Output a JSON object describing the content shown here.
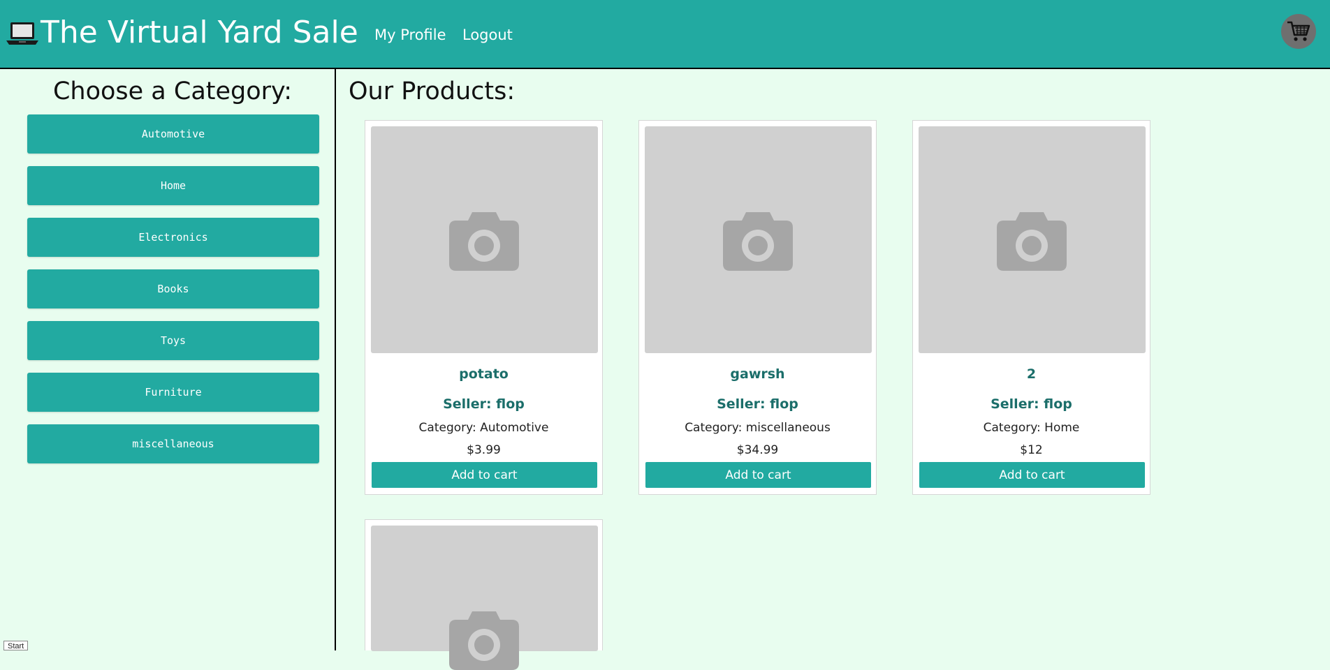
{
  "header": {
    "logo_icon": "laptop-icon",
    "title": "The Virtual Yard Sale",
    "nav": {
      "profile": "My Profile",
      "logout": "Logout"
    },
    "cart_icon": "shopping-cart-icon",
    "background": "#22aaa1"
  },
  "sidebar": {
    "heading": "Choose a Category:",
    "categories": [
      "Automotive",
      "Home",
      "Electronics",
      "Books",
      "Toys",
      "Furniture",
      "miscellaneous"
    ]
  },
  "main": {
    "heading": "Our Products:",
    "add_to_cart_label": "Add to cart",
    "products": [
      {
        "name": "potato",
        "seller": "Seller: flop",
        "category": "Category: Automotive",
        "price": "$3.99",
        "image_icon": "camera-placeholder-icon"
      },
      {
        "name": "gawrsh",
        "seller": "Seller: flop",
        "category": "Category: miscellaneous",
        "price": "$34.99",
        "image_icon": "camera-placeholder-icon"
      },
      {
        "name": "2",
        "seller": "Seller: flop",
        "category": "Category: Home",
        "price": "$12",
        "image_icon": "camera-placeholder-icon"
      },
      {
        "image_icon": "camera-placeholder-icon"
      }
    ]
  },
  "tooltip": {
    "start": "Start"
  },
  "colors": {
    "accent": "#22aaa1",
    "page_background": "#e8fdef",
    "product_text": "#1b6e6a"
  }
}
